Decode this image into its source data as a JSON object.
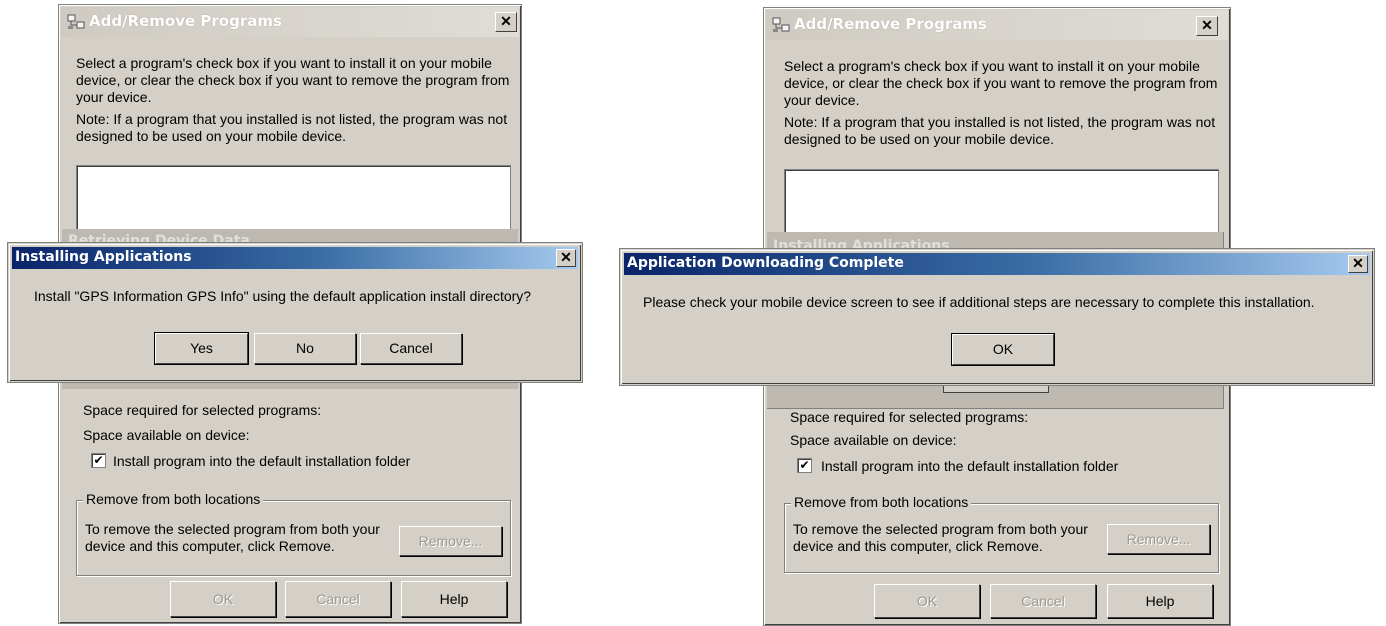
{
  "left": {
    "window_title": "Add/Remove Programs",
    "close_glyph": "✕",
    "intro_text": "Select a program's check box if you want to install it on your mobile device, or clear the check box if you want to remove the program from your device.",
    "note_text": "Note:  If a program that you installed is not listed, the program was not designed to be used on your mobile device.",
    "background_status": "Retrieving Device Data",
    "space_required_label": "Space required for selected programs:",
    "space_available_label": "Space available on device:",
    "install_checkbox_label": "Install program into the default installation folder",
    "install_checkbox_checked": true,
    "remove_group_label": "Remove from both locations",
    "remove_text": "To remove the selected program from both your device and this computer, click Remove.",
    "remove_button": "Remove...",
    "ok_button": "OK",
    "cancel_button": "Cancel",
    "help_button": "Help",
    "dialog": {
      "title": "Installing Applications",
      "message": "Install \"GPS Information GPS Info\" using the default application install directory?",
      "yes_button": "Yes",
      "no_button": "No",
      "cancel_button": "Cancel",
      "close_glyph": "✕"
    }
  },
  "right": {
    "window_title": "Add/Remove Programs",
    "close_glyph": "✕",
    "intro_text": "Select a program's check box if you want to install it on your mobile device, or clear the check box if you want to remove the program from your device.",
    "note_text": "Note:  If a program that you installed is not listed, the program was not designed to be used on your mobile device.",
    "background_status": "Installing Applications",
    "space_required_label": "Space required for selected programs:",
    "space_available_label": "Space available on device:",
    "install_checkbox_label": "Install program into the default installation folder",
    "install_checkbox_checked": true,
    "remove_group_label": "Remove from both locations",
    "remove_text": "To remove the selected program from both your device and this computer, click Remove.",
    "remove_button": "Remove...",
    "ok_button": "OK",
    "cancel_button": "Cancel",
    "help_button": "Help",
    "dialog": {
      "title": "Application Downloading Complete",
      "message": "Please check your mobile device screen to see if additional steps are necessary to complete this installation.",
      "ok_button": "OK",
      "close_glyph": "✕"
    }
  },
  "checkmark_glyph": "✔"
}
